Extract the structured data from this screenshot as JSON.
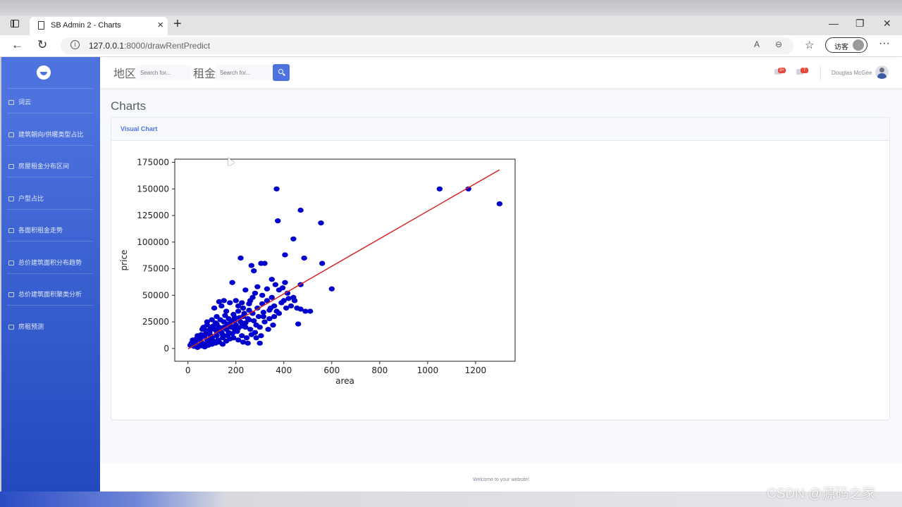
{
  "browser": {
    "tab_title": "SB Admin 2 - Charts",
    "url_host": "127.0.0.1",
    "url_rest": ":8000/drawRentPredict",
    "guest_label": "访客"
  },
  "sidebar": {
    "items": [
      {
        "label": "词云"
      },
      {
        "label": "建筑朝向/供暖类型占比"
      },
      {
        "label": "房屋租金分布区间"
      },
      {
        "label": "户型占比"
      },
      {
        "label": "各面积租金走势"
      },
      {
        "label": "总价建筑面积分布趋势"
      },
      {
        "label": "总价建筑面积聚类分析"
      },
      {
        "label": "房租预测"
      }
    ]
  },
  "topbar": {
    "region_label": "地区",
    "rent_label": "租金",
    "search_placeholder": "Search for...",
    "alerts_badge": "3+",
    "messages_badge": "7",
    "user_name": "Douglas McGee"
  },
  "page": {
    "heading": "Charts",
    "card_title": "Visual Chart",
    "footer": "Welcome to your website!"
  },
  "watermark": "CSDN @源码之家",
  "colors": {
    "accent": "#4e73df",
    "points": "#0000cc",
    "fit_line": "#d62728"
  },
  "chart_data": {
    "type": "scatter",
    "title": "",
    "xlabel": "area",
    "ylabel": "price",
    "xlim": [
      -55,
      1365
    ],
    "ylim": [
      -12000,
      178000
    ],
    "xticks": [
      0,
      200,
      400,
      600,
      800,
      1000,
      1200
    ],
    "yticks": [
      0,
      25000,
      50000,
      75000,
      100000,
      125000,
      150000,
      175000
    ],
    "series": [
      {
        "points": [
          [
            370,
            150000
          ],
          [
            1050,
            150000
          ],
          [
            1170,
            150000
          ],
          [
            1300,
            136000
          ],
          [
            470,
            130000
          ],
          [
            375,
            120000
          ],
          [
            555,
            118000
          ],
          [
            440,
            103000
          ],
          [
            220,
            85000
          ],
          [
            405,
            88000
          ],
          [
            485,
            85000
          ],
          [
            560,
            80000
          ],
          [
            305,
            80000
          ],
          [
            265,
            78000
          ],
          [
            320,
            80000
          ],
          [
            275,
            73000
          ],
          [
            350,
            65000
          ],
          [
            365,
            60000
          ],
          [
            405,
            62000
          ],
          [
            470,
            60000
          ],
          [
            600,
            56000
          ],
          [
            185,
            62000
          ],
          [
            240,
            55000
          ],
          [
            290,
            58000
          ],
          [
            330,
            56000
          ],
          [
            380,
            55000
          ],
          [
            415,
            52000
          ],
          [
            440,
            48000
          ],
          [
            470,
            37000
          ],
          [
            490,
            35000
          ],
          [
            510,
            35000
          ],
          [
            460,
            23000
          ],
          [
            345,
            38000
          ],
          [
            315,
            30000
          ],
          [
            285,
            22000
          ],
          [
            300,
            5000
          ],
          [
            200,
            45000
          ],
          [
            225,
            43000
          ],
          [
            255,
            42000
          ],
          [
            270,
            48000
          ],
          [
            175,
            43000
          ],
          [
            140,
            40000
          ],
          [
            160,
            35000
          ],
          [
            120,
            30000
          ],
          [
            100,
            27000
          ],
          [
            80,
            22000
          ],
          [
            60,
            18000
          ],
          [
            40,
            12000
          ],
          [
            20,
            8000
          ],
          [
            10,
            3000
          ],
          [
            30,
            5000
          ],
          [
            50,
            8000
          ],
          [
            70,
            12000
          ],
          [
            90,
            15000
          ],
          [
            110,
            18000
          ],
          [
            130,
            20000
          ],
          [
            150,
            25000
          ],
          [
            170,
            28000
          ],
          [
            190,
            32000
          ],
          [
            210,
            35000
          ],
          [
            230,
            30000
          ],
          [
            250,
            28000
          ],
          [
            270,
            33000
          ],
          [
            290,
            38000
          ],
          [
            310,
            42000
          ],
          [
            330,
            45000
          ],
          [
            360,
            40000
          ],
          [
            390,
            43000
          ],
          [
            410,
            38000
          ],
          [
            430,
            40000
          ],
          [
            60,
            5000
          ],
          [
            80,
            8000
          ],
          [
            100,
            10000
          ],
          [
            120,
            12000
          ],
          [
            140,
            15000
          ],
          [
            160,
            18000
          ],
          [
            180,
            20000
          ],
          [
            200,
            22000
          ],
          [
            220,
            25000
          ],
          [
            240,
            20000
          ],
          [
            260,
            18000
          ],
          [
            280,
            15000
          ],
          [
            300,
            20000
          ],
          [
            320,
            25000
          ],
          [
            340,
            28000
          ],
          [
            360,
            30000
          ],
          [
            380,
            33000
          ],
          [
            45,
            3000
          ],
          [
            65,
            4000
          ],
          [
            85,
            6000
          ],
          [
            105,
            7000
          ],
          [
            125,
            8000
          ],
          [
            145,
            10000
          ],
          [
            165,
            12000
          ],
          [
            185,
            14000
          ],
          [
            205,
            16000
          ],
          [
            225,
            12000
          ],
          [
            245,
            10000
          ],
          [
            265,
            13000
          ],
          [
            285,
            10000
          ],
          [
            305,
            12000
          ],
          [
            35,
            9000
          ],
          [
            55,
            13000
          ],
          [
            75,
            17000
          ],
          [
            95,
            20000
          ],
          [
            115,
            24000
          ],
          [
            135,
            27000
          ],
          [
            155,
            31000
          ],
          [
            175,
            22000
          ],
          [
            195,
            26000
          ],
          [
            215,
            29000
          ],
          [
            235,
            33000
          ],
          [
            255,
            36000
          ],
          [
            275,
            26000
          ],
          [
            295,
            30000
          ],
          [
            315,
            34000
          ],
          [
            335,
            18000
          ],
          [
            355,
            22000
          ],
          [
            25,
            2000
          ],
          [
            40,
            1000
          ],
          [
            55,
            2500
          ],
          [
            70,
            1500
          ],
          [
            85,
            3000
          ],
          [
            100,
            4000
          ],
          [
            115,
            5000
          ],
          [
            130,
            6000
          ],
          [
            145,
            4000
          ],
          [
            160,
            7000
          ],
          [
            175,
            9000
          ],
          [
            190,
            10000
          ],
          [
            210,
            8000
          ],
          [
            230,
            6000
          ],
          [
            250,
            5000
          ],
          [
            150,
            45000
          ],
          [
            130,
            44000
          ],
          [
            110,
            38000
          ],
          [
            210,
            40000
          ],
          [
            230,
            38000
          ],
          [
            260,
            45000
          ],
          [
            280,
            52000
          ],
          [
            310,
            50000
          ],
          [
            350,
            48000
          ],
          [
            395,
            57000
          ],
          [
            15,
            5000
          ],
          [
            30,
            7000
          ],
          [
            45,
            10000
          ],
          [
            60,
            11000
          ],
          [
            75,
            14000
          ],
          [
            90,
            17000
          ],
          [
            105,
            21000
          ],
          [
            120,
            23000
          ],
          [
            135,
            17000
          ],
          [
            150,
            20000
          ],
          [
            165,
            23000
          ],
          [
            180,
            26000
          ],
          [
            195,
            29000
          ],
          [
            210,
            19000
          ],
          [
            225,
            21000
          ],
          [
            240,
            24000
          ],
          [
            255,
            27000
          ],
          [
            195,
            18000
          ],
          [
            170,
            15000
          ],
          [
            145,
            13000
          ],
          [
            120,
            16000
          ],
          [
            95,
            12000
          ],
          [
            80,
            25000
          ],
          [
            65,
            20000
          ],
          [
            340,
            36000
          ],
          [
            370,
            35000
          ],
          [
            400,
            45000
          ],
          [
            420,
            47000
          ],
          [
            445,
            45000
          ],
          [
            455,
            38000
          ]
        ],
        "fit_line": [
          [
            0,
            -500
          ],
          [
            1300,
            168000
          ]
        ]
      }
    ]
  }
}
